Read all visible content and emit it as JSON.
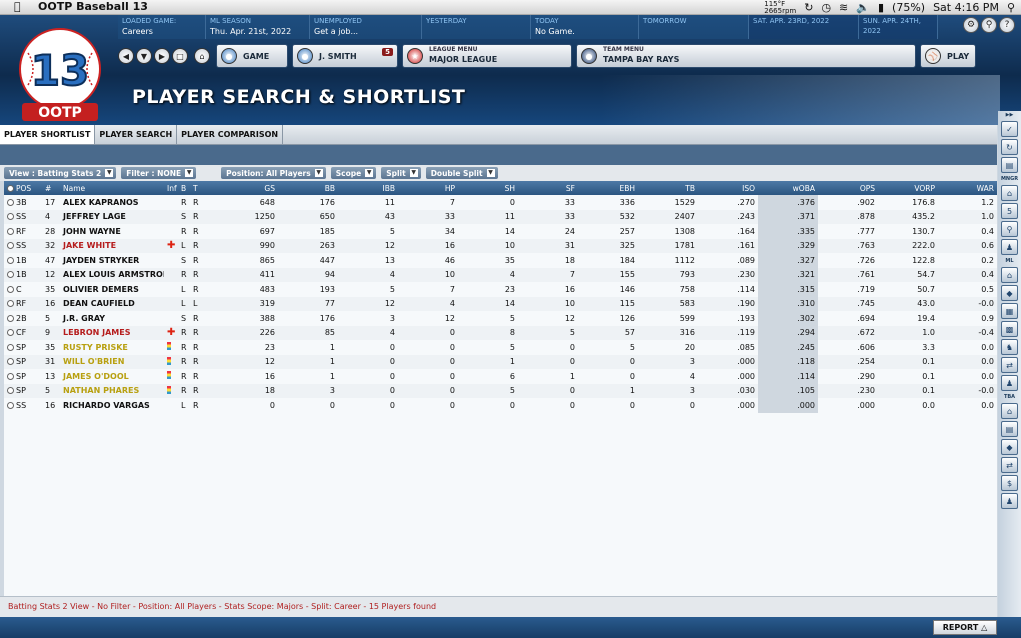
{
  "menubar": {
    "app_name": "OOTP Baseball 13",
    "temp": "115°F",
    "rpm": "2665rpm",
    "battery": "(75%)",
    "clock": "Sat 4:16 PM"
  },
  "info": [
    {
      "label": "LOADED GAME:",
      "value": "Careers"
    },
    {
      "label": "ML SEASON",
      "value": "Thu. Apr. 21st, 2022"
    },
    {
      "label": "UNEMPLOYED",
      "value": "Get a job..."
    },
    {
      "label": "YESTERDAY",
      "value": ""
    },
    {
      "label": "TODAY",
      "value": "No Game."
    },
    {
      "label": "TOMORROW",
      "value": ""
    },
    {
      "label": "Sat. Apr. 23rd, 2022",
      "value": ""
    },
    {
      "label": "Sun. Apr. 24th, 2022",
      "value": ""
    }
  ],
  "nav": {
    "game": "GAME",
    "manager": "J. SMITH",
    "manager_badge": "5",
    "league_menu_label": "LEAGUE MENU",
    "league": "MAJOR LEAGUE",
    "team_menu_label": "TEAM MENU",
    "team": "TAMPA BAY RAYS",
    "play": "PLAY"
  },
  "page_title": "PLAYER SEARCH & SHORTLIST",
  "tabs": [
    "PLAYER SHORTLIST",
    "PLAYER SEARCH",
    "PLAYER COMPARISON"
  ],
  "filters": {
    "view": "View : Batting Stats 2",
    "filter": "Filter : NONE",
    "position": "Position: All Players",
    "scope": "Scope",
    "split": "Split",
    "double_split": "Double Split"
  },
  "columns": [
    "POS",
    "#",
    "Name",
    "Inf",
    "B",
    "T",
    "GS",
    "BB",
    "IBB",
    "HP",
    "SH",
    "SF",
    "EBH",
    "TB",
    "ISO",
    "wOBA",
    "OPS",
    "VORP",
    "WAR"
  ],
  "rows": [
    {
      "pos": "3B",
      "num": "17",
      "name": "ALEX KAPRANOS",
      "inf": "",
      "b": "R",
      "t": "R",
      "gs": "648",
      "bb": "176",
      "ibb": "11",
      "hp": "7",
      "sh": "0",
      "sf": "33",
      "ebh": "336",
      "tb": "1529",
      "iso": ".270",
      "woba": ".376",
      "ops": ".902",
      "vorp": "176.8",
      "war": "1.2",
      "color": "#111111"
    },
    {
      "pos": "SS",
      "num": "4",
      "name": "JEFFREY LAGE",
      "inf": "",
      "b": "S",
      "t": "R",
      "gs": "1250",
      "bb": "650",
      "ibb": "43",
      "hp": "33",
      "sh": "11",
      "sf": "33",
      "ebh": "532",
      "tb": "2407",
      "iso": ".243",
      "woba": ".371",
      "ops": ".878",
      "vorp": "435.2",
      "war": "1.0",
      "color": "#111111"
    },
    {
      "pos": "RF",
      "num": "28",
      "name": "JOHN WAYNE",
      "inf": "",
      "b": "R",
      "t": "R",
      "gs": "697",
      "bb": "185",
      "ibb": "5",
      "hp": "34",
      "sh": "14",
      "sf": "24",
      "ebh": "257",
      "tb": "1308",
      "iso": ".164",
      "woba": ".335",
      "ops": ".777",
      "vorp": "130.7",
      "war": "0.4",
      "color": "#111111"
    },
    {
      "pos": "SS",
      "num": "32",
      "name": "JAKE WHITE",
      "inf": "cross",
      "b": "L",
      "t": "R",
      "gs": "990",
      "bb": "263",
      "ibb": "12",
      "hp": "16",
      "sh": "10",
      "sf": "31",
      "ebh": "325",
      "tb": "1781",
      "iso": ".161",
      "woba": ".329",
      "ops": ".763",
      "vorp": "222.0",
      "war": "0.6",
      "color": "#b51c1c"
    },
    {
      "pos": "1B",
      "num": "47",
      "name": "JAYDEN STRYKER",
      "inf": "",
      "b": "S",
      "t": "R",
      "gs": "865",
      "bb": "447",
      "ibb": "13",
      "hp": "46",
      "sh": "35",
      "sf": "18",
      "ebh": "184",
      "tb": "1112",
      "iso": ".089",
      "woba": ".327",
      "ops": ".726",
      "vorp": "122.8",
      "war": "0.2",
      "color": "#111111"
    },
    {
      "pos": "1B",
      "num": "12",
      "name": "ALEX LOUIS ARMSTRONG",
      "inf": "",
      "b": "R",
      "t": "R",
      "gs": "411",
      "bb": "94",
      "ibb": "4",
      "hp": "10",
      "sh": "4",
      "sf": "7",
      "ebh": "155",
      "tb": "793",
      "iso": ".230",
      "woba": ".321",
      "ops": ".761",
      "vorp": "54.7",
      "war": "0.4",
      "color": "#111111"
    },
    {
      "pos": "C",
      "num": "35",
      "name": "OLIVIER DEMERS",
      "inf": "",
      "b": "L",
      "t": "R",
      "gs": "483",
      "bb": "193",
      "ibb": "5",
      "hp": "7",
      "sh": "23",
      "sf": "16",
      "ebh": "146",
      "tb": "758",
      "iso": ".114",
      "woba": ".315",
      "ops": ".719",
      "vorp": "50.7",
      "war": "0.5",
      "color": "#111111"
    },
    {
      "pos": "RF",
      "num": "16",
      "name": "DEAN CAUFIELD",
      "inf": "",
      "b": "L",
      "t": "L",
      "gs": "319",
      "bb": "77",
      "ibb": "12",
      "hp": "4",
      "sh": "14",
      "sf": "10",
      "ebh": "115",
      "tb": "583",
      "iso": ".190",
      "woba": ".310",
      "ops": ".745",
      "vorp": "43.0",
      "war": "-0.0",
      "color": "#111111"
    },
    {
      "pos": "2B",
      "num": "5",
      "name": "J.R. GRAY",
      "inf": "",
      "b": "S",
      "t": "R",
      "gs": "388",
      "bb": "176",
      "ibb": "3",
      "hp": "12",
      "sh": "5",
      "sf": "12",
      "ebh": "126",
      "tb": "599",
      "iso": ".193",
      "woba": ".302",
      "ops": ".694",
      "vorp": "19.4",
      "war": "0.9",
      "color": "#111111"
    },
    {
      "pos": "CF",
      "num": "9",
      "name": "LEBRON JAMES",
      "inf": "cross",
      "b": "R",
      "t": "R",
      "gs": "226",
      "bb": "85",
      "ibb": "4",
      "hp": "0",
      "sh": "8",
      "sf": "5",
      "ebh": "57",
      "tb": "316",
      "iso": ".119",
      "woba": ".294",
      "ops": ".672",
      "vorp": "1.0",
      "war": "-0.4",
      "color": "#b51c1c"
    },
    {
      "pos": "SP",
      "num": "35",
      "name": "RUSTY PRISKE",
      "inf": "cards",
      "b": "R",
      "t": "R",
      "gs": "23",
      "bb": "1",
      "ibb": "0",
      "hp": "0",
      "sh": "5",
      "sf": "0",
      "ebh": "5",
      "tb": "20",
      "iso": ".085",
      "woba": ".245",
      "ops": ".606",
      "vorp": "3.3",
      "war": "0.0",
      "color": "#b8a010"
    },
    {
      "pos": "SP",
      "num": "31",
      "name": "WILL O'BRIEN",
      "inf": "cards",
      "b": "R",
      "t": "R",
      "gs": "12",
      "bb": "1",
      "ibb": "0",
      "hp": "0",
      "sh": "1",
      "sf": "0",
      "ebh": "0",
      "tb": "3",
      "iso": ".000",
      "woba": ".118",
      "ops": ".254",
      "vorp": "0.1",
      "war": "0.0",
      "color": "#b8a010"
    },
    {
      "pos": "SP",
      "num": "13",
      "name": "JAMES O'DOOL",
      "inf": "cards",
      "b": "R",
      "t": "R",
      "gs": "16",
      "bb": "1",
      "ibb": "0",
      "hp": "0",
      "sh": "6",
      "sf": "1",
      "ebh": "0",
      "tb": "4",
      "iso": ".000",
      "woba": ".114",
      "ops": ".290",
      "vorp": "0.1",
      "war": "0.0",
      "color": "#b8a010"
    },
    {
      "pos": "SP",
      "num": "5",
      "name": "NATHAN PHARES",
      "inf": "cards",
      "b": "R",
      "t": "R",
      "gs": "18",
      "bb": "3",
      "ibb": "0",
      "hp": "0",
      "sh": "5",
      "sf": "0",
      "ebh": "1",
      "tb": "3",
      "iso": ".030",
      "woba": ".105",
      "ops": ".230",
      "vorp": "0.1",
      "war": "-0.0",
      "color": "#b8a010"
    },
    {
      "pos": "SS",
      "num": "16",
      "name": "RICHARDO VARGAS",
      "inf": "",
      "b": "L",
      "t": "R",
      "gs": "0",
      "bb": "0",
      "ibb": "0",
      "hp": "0",
      "sh": "0",
      "sf": "0",
      "ebh": "0",
      "tb": "0",
      "iso": ".000",
      "woba": ".000",
      "ops": ".000",
      "vorp": "0.0",
      "war": "0.0",
      "color": "#111111"
    }
  ],
  "status": "Batting Stats 2 View - No Filter - Position: All Players - Stats Scope: Majors - Split: Career - 15 Players found",
  "report": "REPORT",
  "sidebar": {
    "mngr": "MNGR",
    "mngr_badge": "5",
    "ml": "ML",
    "tba": "TBA"
  }
}
